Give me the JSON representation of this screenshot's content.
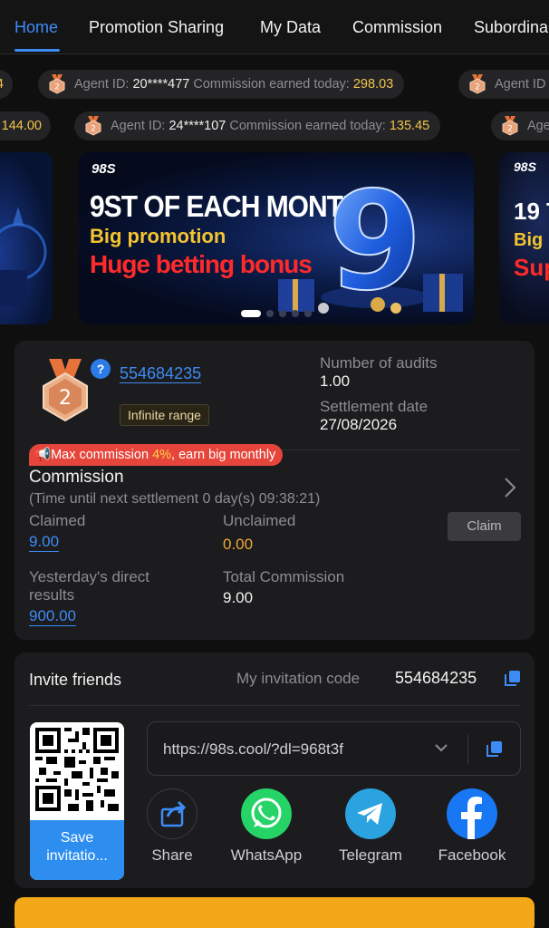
{
  "tabs": [
    {
      "label": "Home",
      "active": true
    },
    {
      "label": "Promotion Sharing",
      "active": false
    },
    {
      "label": "My Data",
      "active": false
    },
    {
      "label": "Commission",
      "active": false
    },
    {
      "label": "Subordina",
      "active": false
    }
  ],
  "ticker": {
    "row1": {
      "partial_left": "4",
      "items": [
        {
          "level": "2",
          "prefix": "Agent ID:",
          "agent_id": "20****477",
          "earned_label": "Commission earned today:",
          "amount": "298.03"
        },
        {
          "level": "2",
          "prefix": "Agent ID",
          "agent_id": "",
          "earned_label": "",
          "amount": ""
        }
      ]
    },
    "row2": {
      "partial_left": "144.00",
      "items": [
        {
          "level": "2",
          "prefix": "Agent ID:",
          "agent_id": "24****107",
          "earned_label": "Commission earned today:",
          "amount": "135.45"
        },
        {
          "level": "2",
          "prefix": "Age",
          "agent_id": "",
          "earned_label": "",
          "amount": ""
        }
      ]
    }
  },
  "banner": {
    "brand": "98S",
    "line1": "9ST OF EACH MONTH",
    "line2": "Big promotion",
    "line3": "Huge betting bonus",
    "big_digit": "9",
    "right_line1": "19 T",
    "right_line2": "Big p",
    "right_line3": "Sup",
    "active_slide": 0,
    "slides": 5
  },
  "stats": {
    "level": "2",
    "help": "?",
    "user_id": "554684235",
    "range_tag": "Infinite range",
    "audits_label": "Number of audits",
    "audits_value": "1.00",
    "settlement_label": "Settlement date",
    "settlement_value": "27/08/2026",
    "promo": {
      "prefix": "Max commission",
      "pct": "4%",
      "suffix": ", earn big monthly"
    },
    "commission_title": "Commission",
    "next_settlement": "(Time until next settlement  0 day(s) 09:38:21)",
    "claimed_label": "Claimed",
    "claimed_value": "9.00",
    "unclaimed_label": "Unclaimed",
    "unclaimed_value": "0.00",
    "claim_button": "Claim",
    "yesterday_label_1": "Yesterday's direct",
    "yesterday_label_2": "results",
    "yesterday_value": "900.00",
    "total_label": "Total Commission",
    "total_value": "9.00"
  },
  "invite": {
    "title": "Invite friends",
    "code_label": "My invitation code",
    "code": "554684235",
    "link": "https://98s.cool/?dl=968t3f",
    "save_label_1": "Save",
    "save_label_2": "invitatio...",
    "share": [
      {
        "label": "Share",
        "icon": "share-icon",
        "color": "#1c1c1e"
      },
      {
        "label": "WhatsApp",
        "icon": "whatsapp-icon",
        "color": "#25d366"
      },
      {
        "label": "Telegram",
        "icon": "telegram-icon",
        "color": "#2aa3e0"
      },
      {
        "label": "Facebook",
        "icon": "facebook-icon",
        "color": "#1877f2"
      }
    ]
  },
  "colors": {
    "accent": "#3d8bf5",
    "gold": "#f3c54b",
    "promo_red": "#e5453a",
    "strip": "#f2a818"
  }
}
